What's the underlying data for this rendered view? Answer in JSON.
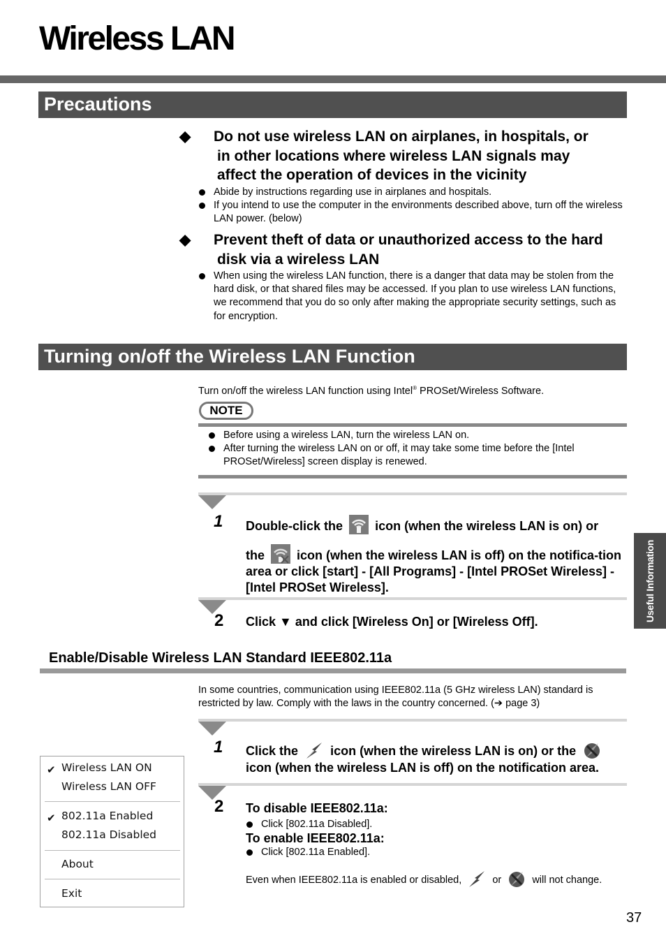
{
  "page": {
    "title": "Wireless LAN",
    "page_number": "37",
    "side_tab": "Useful Information"
  },
  "precautions": {
    "heading": "Precautions",
    "warnings": [
      {
        "symbol": "◆",
        "lines": [
          "Do not use wireless LAN on airplanes, in hospitals, or",
          "in other locations where wireless LAN signals may",
          "affect the operation of devices in the vicinity"
        ],
        "bullets": [
          "Abide by instructions regarding use in airplanes and hospitals.",
          "If you intend to use the computer in the environments described above, turn off the wireless LAN power. (below)"
        ]
      },
      {
        "symbol": "◆",
        "lines": [
          "Prevent theft of data or unauthorized access to the hard",
          "disk via a wireless LAN"
        ],
        "bullets": [
          "When using the wireless LAN function, there is a danger that data may be stolen from the hard disk, or that shared files may be accessed. If you plan to use wireless LAN functions, we recommend that you do so only after making the appropriate security settings, such as for encryption."
        ]
      }
    ]
  },
  "turning": {
    "heading": "Turning on/off the Wireless LAN Function",
    "intro_before": "Turn on/off the wireless LAN function using Intel",
    "intro_sup": "®",
    "intro_after": " PROSet/Wireless Software.",
    "note_label": "NOTE",
    "notes": [
      "Before using a wireless LAN, turn the wireless LAN on.",
      "After turning the wireless LAN on or off, it may take some time before the [Intel PROSet/Wireless] screen display is renewed."
    ],
    "steps": [
      {
        "number": "1",
        "part1": "Double-click the",
        "part2": "icon (when the wireless LAN is on) or",
        "part3": "the",
        "part4": "icon (when the wireless LAN is off) on the notifica-tion area or click [start] - [All Programs] - [Intel PROSet Wireless] - [Intel PROSet Wireless].",
        "icon_on": "wifi-tray-on-icon",
        "icon_off": "wifi-tray-off-icon"
      },
      {
        "number": "2",
        "text": "Click ▼ and click [Wireless On] or [Wireless Off]."
      }
    ]
  },
  "ieee": {
    "heading": "Enable/Disable Wireless LAN Standard IEEE802.11a",
    "intro": "In some countries, communication using IEEE802.11a (5 GHz wireless LAN) standard is restricted by law. Comply with the laws in the country concerned. (➔ page 3)",
    "steps": [
      {
        "number": "1",
        "part1": "Click the",
        "part2": "icon (when the wireless LAN is on) or the",
        "part3": "icon (when the wireless LAN is off) on the notification area.",
        "icon_on": "lightning-tray-on-icon",
        "icon_off": "lightning-tray-off-icon"
      },
      {
        "number": "2",
        "disable_heading": "To disable IEEE802.11a:",
        "disable_bullet": "Click [802.11a Disabled].",
        "enable_heading": "To enable IEEE802.11a:",
        "enable_bullet": "Click [802.11a Enabled].",
        "footer_before": "Even when IEEE802.11a is enabled or disabled,",
        "footer_or": "or",
        "footer_after": "will not change."
      }
    ],
    "menu": {
      "items": [
        {
          "label": "Wireless LAN ON",
          "checked": true
        },
        {
          "label": "Wireless LAN OFF",
          "checked": false
        },
        {
          "label": "802.11a Enabled",
          "checked": true
        },
        {
          "label": "802.11a Disabled",
          "checked": false
        },
        {
          "label": "About",
          "checked": false
        },
        {
          "label": "Exit",
          "checked": false
        }
      ],
      "check_glyph": "✔"
    }
  }
}
